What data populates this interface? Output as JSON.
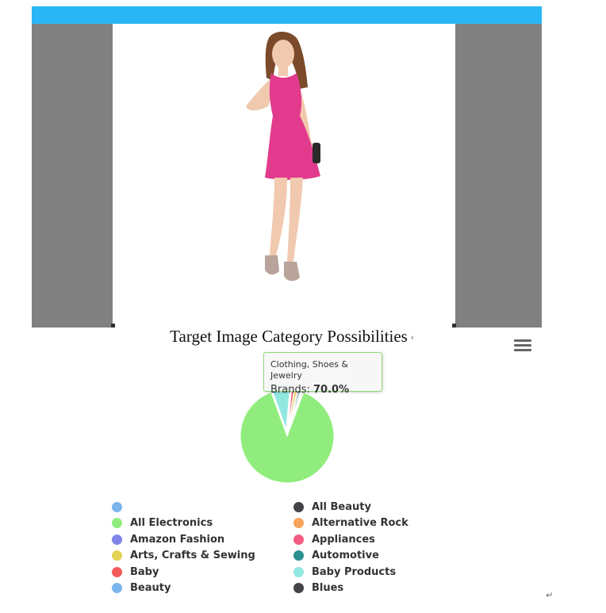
{
  "colors": {
    "topbar": "#29b6f6",
    "viewer_bg": "#808080",
    "menu_icon": "#666666",
    "tooltip_border": "#90d97a"
  },
  "product_image": {
    "dress_color": "#e23a8d",
    "skin_color": "#f1c9ae",
    "hair_color": "#7a4a2a"
  },
  "chart": {
    "title_tick": "‹",
    "menu_icon": "hamburger-menu-icon"
  },
  "chart_data": {
    "type": "pie",
    "title": "Target Image Category Possibilities",
    "series": [
      {
        "name": "Brands",
        "slices": [
          {
            "category": "Clothing, Shoes & Jewelry",
            "value": 70.0,
            "color": "#90ed7d"
          },
          {
            "category": "Baby Products",
            "value": 5.5,
            "color": "#91e8e1"
          },
          {
            "category": "Appliances",
            "value": 0.8,
            "color": "#f15c80"
          },
          {
            "category": "Arts, Crafts & Sewing",
            "value": 0.8,
            "color": "#e4d354"
          },
          {
            "category": "Baby",
            "value": 0.4,
            "color": "#f45b5b"
          },
          {
            "category": "Automotive",
            "value": 0.5,
            "color": "#2b908f"
          },
          {
            "category": "Beauty",
            "value": 0.3,
            "color": "#7cb5ec"
          },
          {
            "category": "Alternative Rock",
            "value": 0.3,
            "color": "#f7a35c"
          },
          {
            "category": "All Beauty",
            "value": 0.3,
            "color": "#434348"
          }
        ]
      }
    ],
    "tooltip": {
      "category": "Clothing, Shoes & Jewelry",
      "series_name": "Brands",
      "value_label": "70.0%"
    },
    "legend": {
      "placement": "bottom",
      "columns": 2,
      "items": [
        {
          "label": "",
          "color": "#7cb5ec"
        },
        {
          "label": "All Electronics",
          "color": "#90ed7d"
        },
        {
          "label": "Amazon Fashion",
          "color": "#8085e9"
        },
        {
          "label": "Arts, Crafts & Sewing",
          "color": "#e4d354"
        },
        {
          "label": "Baby",
          "color": "#f45b5b"
        },
        {
          "label": "Beauty",
          "color": "#7cb5ec"
        },
        {
          "label": "All Beauty",
          "color": "#434348"
        },
        {
          "label": "Alternative Rock",
          "color": "#f7a35c"
        },
        {
          "label": "Appliances",
          "color": "#f15c80"
        },
        {
          "label": "Automotive",
          "color": "#2b908f"
        },
        {
          "label": "Baby Products",
          "color": "#91e8e1"
        },
        {
          "label": "Blues",
          "color": "#434348"
        }
      ]
    }
  },
  "footer": {
    "return_mark": "↵"
  }
}
